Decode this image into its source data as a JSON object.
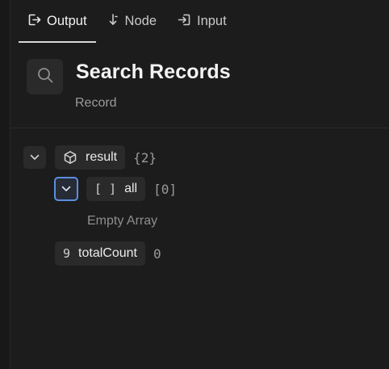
{
  "tabs": [
    {
      "label": "Output",
      "icon": "output-icon"
    },
    {
      "label": "Node",
      "icon": "node-icon"
    },
    {
      "label": "Input",
      "icon": "input-icon"
    }
  ],
  "header": {
    "title": "Search Records",
    "subtitle": "Record"
  },
  "tree": {
    "result": {
      "key": "result",
      "count": "{2}"
    },
    "all": {
      "key": "all",
      "count": "[0]",
      "empty_label": "Empty Array",
      "type_icon": "[ ]"
    },
    "totalCount": {
      "key": "totalCount",
      "value": "0",
      "type_icon": "9"
    }
  },
  "colors": {
    "background": "#1c1c1c",
    "pill": "#2a2a2a",
    "focus_ring": "#5b8fe0"
  }
}
